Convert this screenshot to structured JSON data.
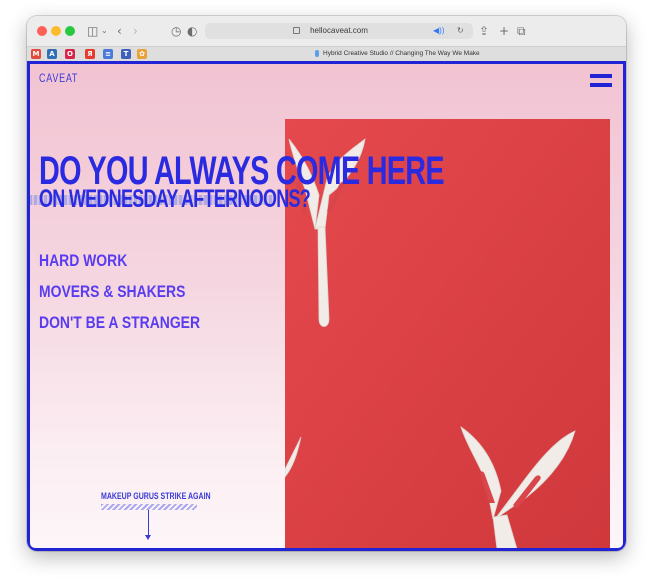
{
  "browser": {
    "url": "hellocaveat.com",
    "tab_title": "Hybrid Creative Studio // Changing The Way We Make",
    "favorites": [
      {
        "label": "M",
        "color": "#e24a3b"
      },
      {
        "label": "A",
        "color": "#2f6fb5"
      },
      {
        "label": "O",
        "color": "#d6264a"
      },
      {
        "label": "Я",
        "color": "#e63a2e"
      },
      {
        "label": "≡",
        "color": "#4a79d9"
      },
      {
        "label": "T",
        "color": "#3f5fb8"
      },
      {
        "label": "✿",
        "color": "#e9a23a"
      }
    ]
  },
  "site": {
    "logo": "CAVEAT",
    "headline_line1": "DO YOU ALWAYS COME HERE",
    "headline_line2": "ON WEDNESDAY AFTERNOONS?",
    "nav": [
      {
        "label": "HARD WORK"
      },
      {
        "label": "MOVERS & SHAKERS"
      },
      {
        "label": "DON'T BE A STRANGER"
      }
    ],
    "scroll_label": "MAKEUP GURUS STRIKE AGAIN",
    "accent_color": "#2323d6",
    "photo_color": "#dc3f43"
  }
}
